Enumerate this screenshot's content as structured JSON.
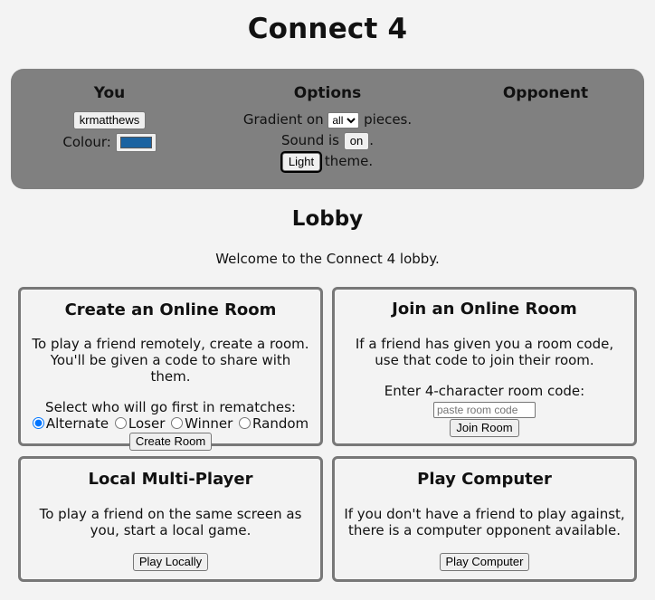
{
  "app": {
    "title": "Connect 4"
  },
  "you": {
    "heading": "You",
    "username": "krmatthews",
    "colour_label": "Colour:",
    "colour": "#1b63a1"
  },
  "options": {
    "heading": "Options",
    "gradient_prefix": "Gradient on",
    "gradient_value": "all",
    "gradient_suffix": "pieces.",
    "sound_prefix": "Sound is",
    "sound_value": "on",
    "theme_value": "Light",
    "theme_suffix": "theme."
  },
  "opponent": {
    "heading": "Opponent"
  },
  "lobby": {
    "title": "Lobby",
    "welcome": "Welcome to the Connect 4 lobby."
  },
  "create_room": {
    "title": "Create an Online Room",
    "desc": "To play a friend remotely, create a room. You'll be given a code to share with them.",
    "select_label": "Select who will go first in rematches:",
    "radios": [
      "Alternate",
      "Loser",
      "Winner",
      "Random"
    ],
    "selected": "Alternate",
    "button": "Create Room"
  },
  "join_room": {
    "title": "Join an Online Room",
    "desc": "If a friend has given you a room code, use that code to join their room.",
    "code_label": "Enter 4-character room code:",
    "placeholder": "paste room code",
    "button": "Join Room"
  },
  "local": {
    "title": "Local Multi-Player",
    "desc": "To play a friend on the same screen as you, start a local game.",
    "button": "Play Locally"
  },
  "computer": {
    "title": "Play Computer",
    "desc": "If you don't have a friend to play against, there is a computer opponent available.",
    "button": "Play Computer"
  },
  "colors": {
    "panel": "#808080",
    "background": "#f3f3f3",
    "card_border": "#777777"
  }
}
